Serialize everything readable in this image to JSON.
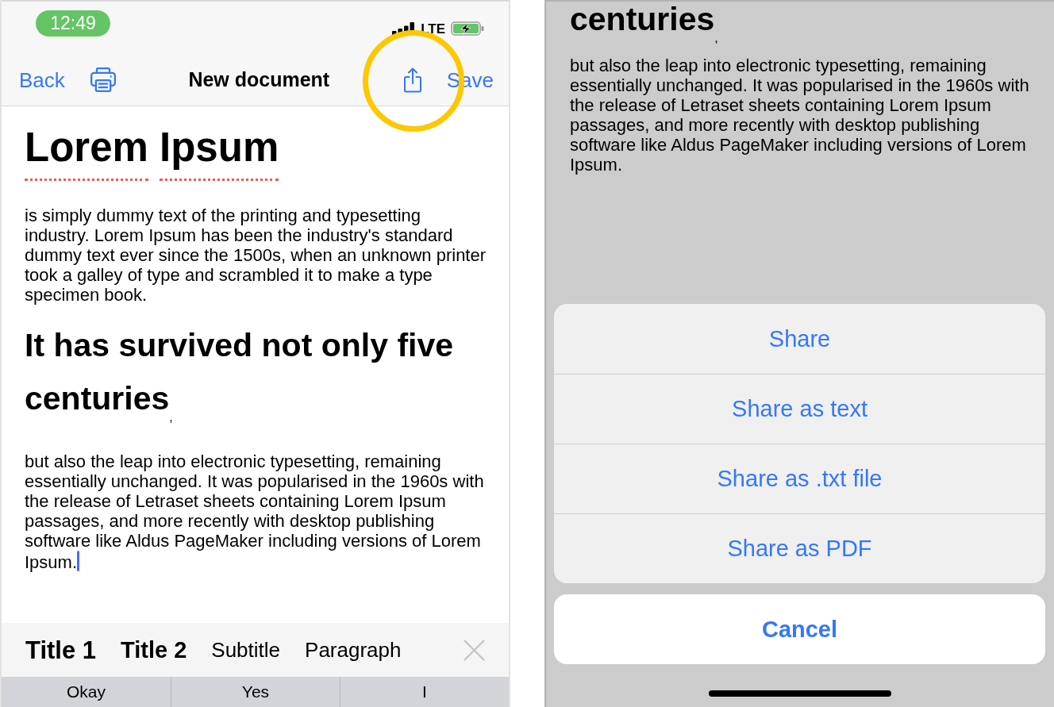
{
  "editor_screen": {
    "status_bar": {
      "time": "12:49",
      "network": "LTE"
    },
    "nav_bar": {
      "back": "Back",
      "title": "New document",
      "save": "Save"
    },
    "document": [
      {
        "kind": "title",
        "text": "Lorem Ipsum",
        "misspelled": true,
        "cursor": false
      },
      {
        "kind": "paragraph",
        "text": "is simply dummy text of the printing and typesetting industry. Lorem Ipsum has been the industry's standard dummy text ever since the 1500s, when an unknown printer took a galley of type and scrambled it to make a type specimen book.",
        "misspelled": false,
        "cursor": false
      },
      {
        "kind": "heading",
        "text": "It has survived not only five centuries",
        "suffix": ",",
        "misspelled": false,
        "cursor": false
      },
      {
        "kind": "paragraph",
        "text": "but also the leap into electronic typesetting, remaining essentially unchanged. It was popularised in the 1960s with the release of Letraset sheets containing Lorem Ipsum passages, and more recently with desktop publishing software like Aldus PageMaker including versions of Lorem Ipsum.",
        "misspelled": false,
        "cursor": true
      }
    ],
    "format_bar": {
      "styles": [
        {
          "kind": "title1",
          "label": "Title 1"
        },
        {
          "kind": "title2",
          "label": "Title 2"
        },
        {
          "kind": "subtitle",
          "label": "Subtitle"
        },
        {
          "kind": "paragraph",
          "label": "Paragraph"
        }
      ]
    },
    "keyboard_suggestions": [
      "Okay",
      "Yes",
      "I"
    ]
  },
  "share_screen": {
    "document": [
      {
        "kind": "heading",
        "text": "centuries",
        "suffix": ",",
        "misspelled": false,
        "cursor": false
      },
      {
        "kind": "paragraph",
        "text": "but also the leap into electronic typesetting, remaining essentially unchanged. It was popularised in the 1960s with the release of Letraset sheets containing Lorem Ipsum passages, and more recently with desktop publishing software like Aldus PageMaker including versions of Lorem Ipsum.",
        "misspelled": false,
        "cursor": false
      }
    ],
    "action_sheet": {
      "options": [
        "Share",
        "Share as text",
        "Share as .txt file",
        "Share as PDF"
      ],
      "cancel": "Cancel"
    }
  }
}
